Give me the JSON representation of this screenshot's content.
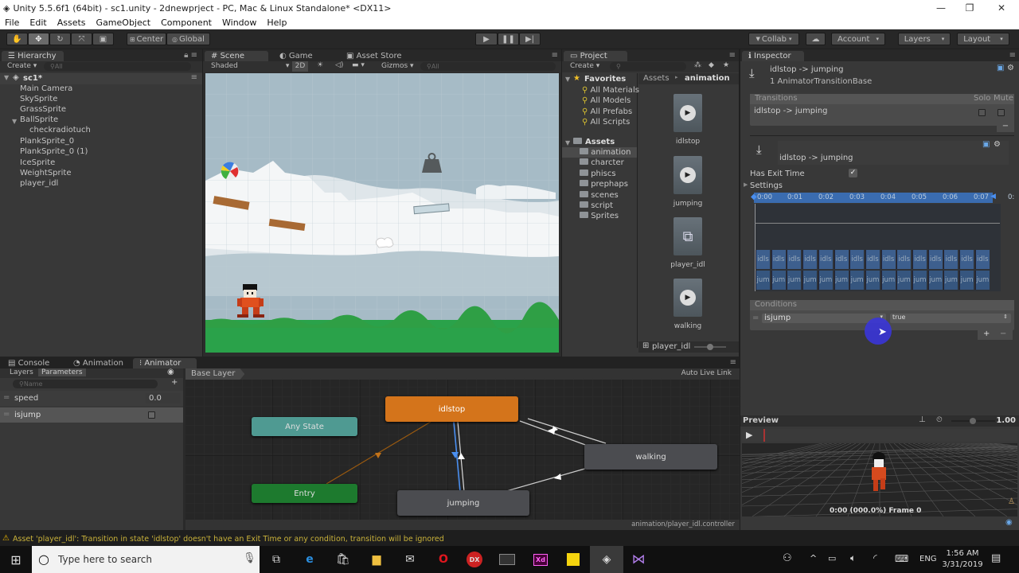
{
  "window": {
    "title": "Unity 5.5.6f1 (64bit) - sc1.unity - 2dnewprject - PC, Mac & Linux Standalone* <DX11>",
    "controls": [
      "minimize-icon",
      "restore-icon",
      "close-icon"
    ]
  },
  "menu": [
    "File",
    "Edit",
    "Assets",
    "GameObject",
    "Component",
    "Window",
    "Help"
  ],
  "toolbar": {
    "tools": [
      "hand-tool",
      "move-tool",
      "rotate-tool",
      "scale-tool",
      "rect-tool"
    ],
    "pivot": "Center",
    "space": "Global",
    "collab": "Collab",
    "account": "Account",
    "layers": "Layers",
    "layout": "Layout"
  },
  "hierarchy": {
    "tab": "Hierarchy",
    "create": "Create",
    "search_placeholder": "All",
    "scene": "sc1*",
    "items": [
      {
        "name": "Main Camera",
        "indent": 0
      },
      {
        "name": "SkySprite",
        "indent": 0
      },
      {
        "name": "GrassSprite",
        "indent": 0
      },
      {
        "name": "BallSprite",
        "indent": 0,
        "expanded": true
      },
      {
        "name": "checkradiotuch",
        "indent": 1
      },
      {
        "name": "PlankSprite_0",
        "indent": 0
      },
      {
        "name": "PlankSprite_0 (1)",
        "indent": 0
      },
      {
        "name": "IceSprite",
        "indent": 0
      },
      {
        "name": "WeightSprite",
        "indent": 0
      },
      {
        "name": "player_idl",
        "indent": 0
      }
    ]
  },
  "scene": {
    "tabs": [
      "Scene",
      "Game",
      "Asset Store"
    ],
    "shading": "Shaded",
    "mode_2d": "2D",
    "gizmos": "Gizmos",
    "search_placeholder": "All"
  },
  "project": {
    "tab": "Project",
    "create": "Create",
    "favorites_label": "Favorites",
    "favorites": [
      "All Materials",
      "All Models",
      "All Prefabs",
      "All Scripts"
    ],
    "assets_label": "Assets",
    "folders": [
      "animation",
      "charcter",
      "phiscs",
      "prephaps",
      "scenes",
      "script",
      "Sprites"
    ],
    "selected_folder": "animation",
    "breadcrumb": [
      "Assets",
      "animation"
    ],
    "assets": [
      {
        "name": "idlstop",
        "type": "animation-clip"
      },
      {
        "name": "jumping",
        "type": "animation-clip"
      },
      {
        "name": "player_idl",
        "type": "animator-controller"
      },
      {
        "name": "walking",
        "type": "animation-clip"
      }
    ],
    "footer_selected": "player_idl"
  },
  "inspector": {
    "tab": "Inspector",
    "title": "idlstop -> jumping",
    "subtitle": "1 AnimatorTransitionBase",
    "transitions_header": "Transitions",
    "solo": "Solo",
    "mute": "Mute",
    "transition_row": "idlstop -> jumping",
    "sub_title": "idlstop -> jumping",
    "has_exit_time_label": "Has Exit Time",
    "has_exit_time": true,
    "settings_label": "Settings",
    "timeline_ticks": [
      "0:00",
      "0:01",
      "0:02",
      "0:03",
      "0:04",
      "0:05",
      "0:06",
      "0:07",
      "0:"
    ],
    "track_a_label": "idls",
    "track_b_label": "jum",
    "conditions_header": "Conditions",
    "condition": {
      "parameter": "isjump",
      "value": "true"
    },
    "preview_label": "Preview",
    "preview_speed": "1.00",
    "preview_status": "0:00 (000.0%) Frame 0"
  },
  "bottom": {
    "tabs": [
      "Console",
      "Animation",
      "Animator"
    ],
    "selected_tab": "Animator",
    "sub_tabs": [
      "Layers",
      "Parameters"
    ],
    "name_placeholder": "Name",
    "parameters": [
      {
        "name": "speed",
        "value": "0.0",
        "type": "float"
      },
      {
        "name": "isjump",
        "value": false,
        "type": "bool"
      }
    ],
    "layer": "Base Layer",
    "auto_live_link": "Auto Live Link",
    "controller_path": "animation/player_idl.controller",
    "states": [
      {
        "name": "idlstop",
        "color": "#d4741b"
      },
      {
        "name": "Any State",
        "color": "#4f9a92"
      },
      {
        "name": "Entry",
        "color": "#1d7a2e"
      },
      {
        "name": "walking",
        "color": "#4b4c50"
      },
      {
        "name": "jumping",
        "color": "#4b4c50"
      }
    ]
  },
  "status": {
    "message": "Asset 'player_idl': Transition in state 'idlstop' doesn't have an Exit Time or any condition, transition will be ignored"
  },
  "taskbar": {
    "search_placeholder": "Type here to search",
    "language": "ENG",
    "time": "1:56 AM",
    "date": "3/31/2019"
  }
}
